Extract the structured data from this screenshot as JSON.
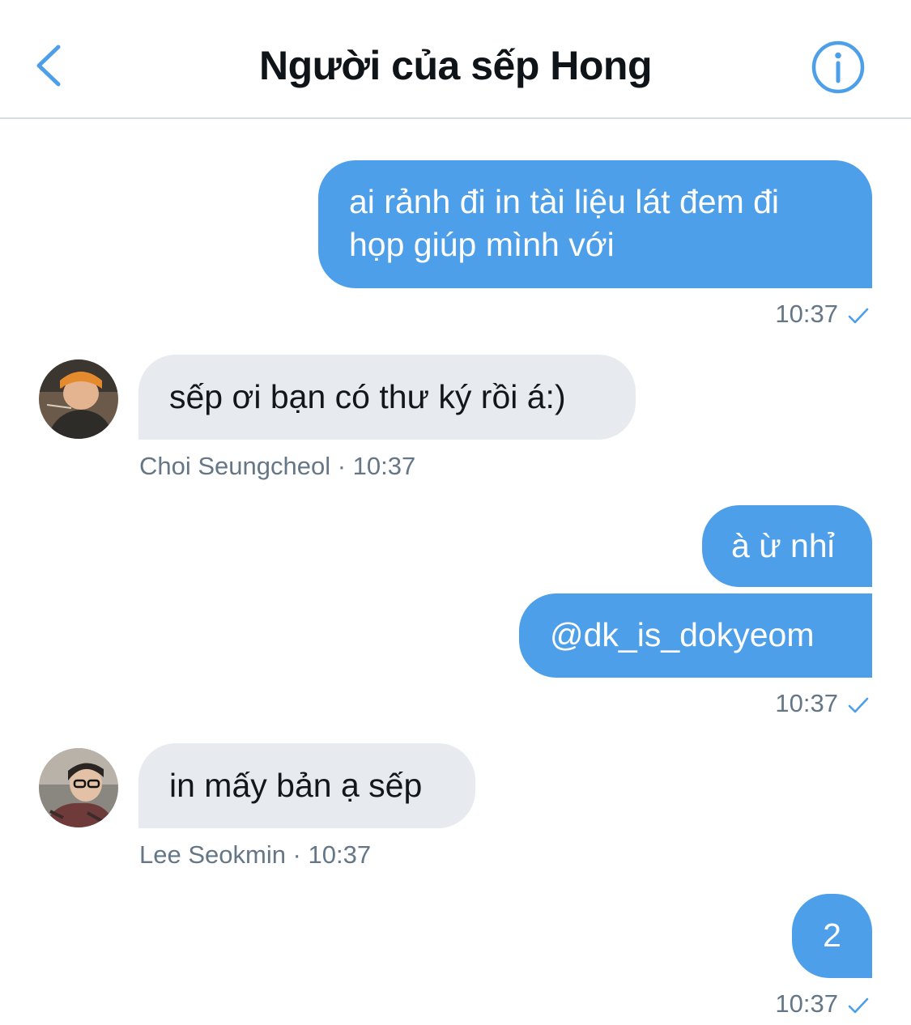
{
  "header": {
    "title": "Người của sếp Hong"
  },
  "messages": [
    {
      "direction": "outgoing",
      "text": "ai rảnh đi in tài liệu lát đem đi họp giúp mình với",
      "time": "10:37"
    },
    {
      "direction": "incoming",
      "text": "sếp ơi bạn có thư ký rồi á:)",
      "meta": "Choi Seungcheol · 10:37"
    },
    {
      "direction": "outgoing",
      "text": "à ừ nhỉ"
    },
    {
      "direction": "outgoing",
      "text": "@dk_is_dokyeom",
      "time": "10:37"
    },
    {
      "direction": "incoming",
      "text": "in mấy bản ạ sếp",
      "meta": "Lee Seokmin · 10:37"
    },
    {
      "direction": "outgoing",
      "text": "2",
      "time": "10:37"
    }
  ],
  "icons": {
    "back": "chevron-left-icon",
    "info": "info-circle-icon",
    "read": "checkmark-icon"
  },
  "colors": {
    "accent": "#4d9fe9",
    "incoming_bubble": "#e7eaef",
    "meta_text": "#657786",
    "title_text": "#0f1419"
  }
}
